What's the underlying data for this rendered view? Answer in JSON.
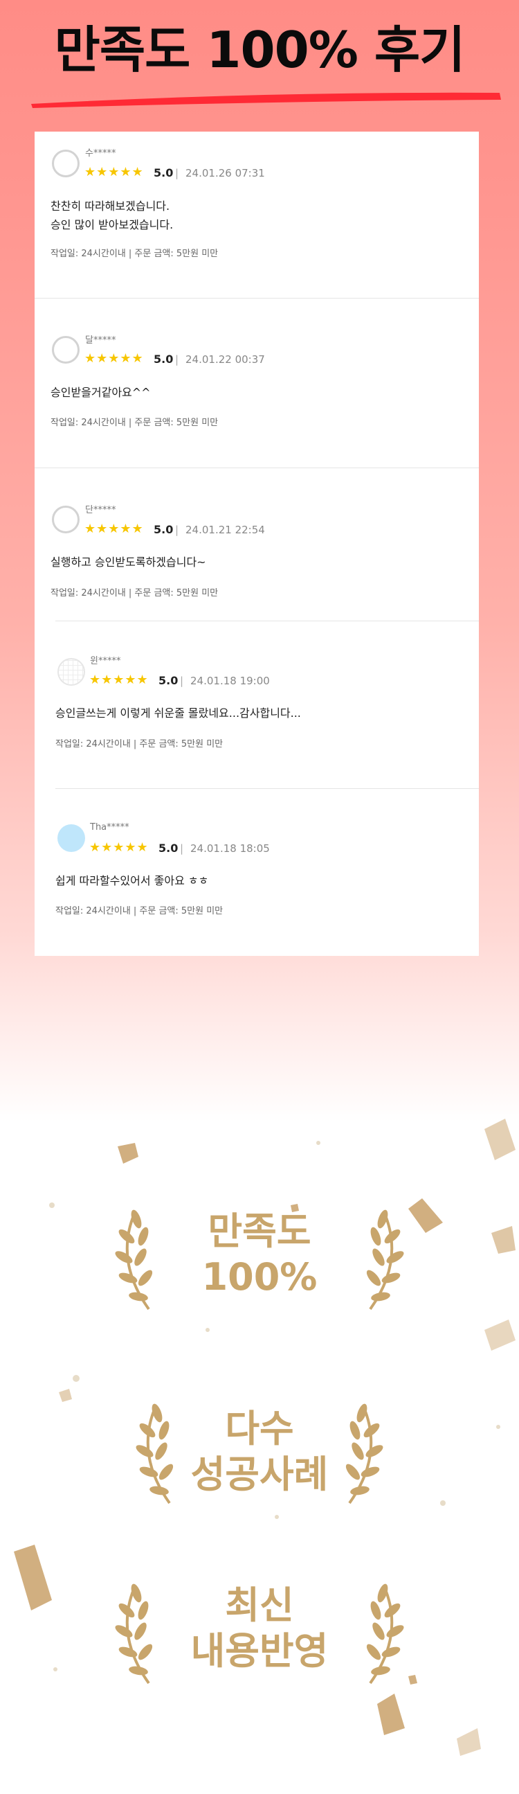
{
  "header": {
    "title": "만족도 100% 후기"
  },
  "reviews": [
    {
      "nick": "수*****",
      "stars": "★★★★★",
      "score": "5.0",
      "date": "24.01.26 07:31",
      "text": "찬찬히 따라해보겠습니다.\n승인 많이 받아보겠습니다.",
      "meta": "작업일: 24시간이내 | 주문 금액: 5만원 미만"
    },
    {
      "nick": "달*****",
      "stars": "★★★★★",
      "score": "5.0",
      "date": "24.01.22 00:37",
      "text": "승인받을거같아요^^",
      "meta": "작업일: 24시간이내 | 주문 금액: 5만원 미만"
    },
    {
      "nick": "단*****",
      "stars": "★★★★★",
      "score": "5.0",
      "date": "24.01.21 22:54",
      "text": "실행하고 승인받도록하겠습니다~",
      "meta": "작업일: 24시간이내 | 주문 금액: 5만원 미만"
    },
    {
      "nick": "윈*****",
      "stars": "★★★★★",
      "score": "5.0",
      "date": "24.01.18 19:00",
      "text": "승인글쓰는게 이렇게 쉬운줄 몰랐네요...감사합니다...",
      "meta": "작업일: 24시간이내 | 주문 금액: 5만원 미만"
    },
    {
      "nick": "Tha*****",
      "stars": "★★★★★",
      "score": "5.0",
      "date": "24.01.18 18:05",
      "text": "쉽게 따라할수있어서 좋아요 ㅎㅎ",
      "meta": "작업일: 24시간이내 | 주문 금액: 5만원 미만"
    }
  ],
  "badges": [
    {
      "label": "만족도\n100%"
    },
    {
      "label": "다수\n성공사례"
    },
    {
      "label": "최신\n내용반영"
    }
  ],
  "colors": {
    "accent_red": "#ff2a35",
    "gold": "#c8a56b",
    "star": "#f7c600"
  }
}
